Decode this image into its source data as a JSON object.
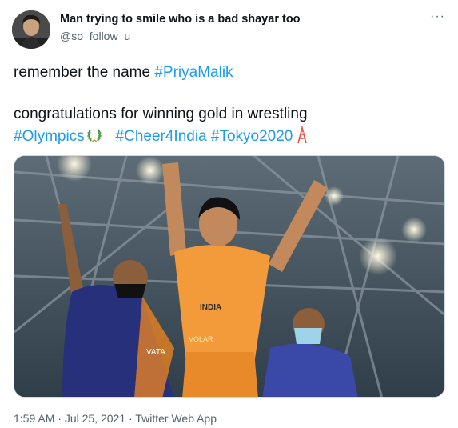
{
  "author": {
    "name": "Man trying to smile who is a bad shayar too",
    "handle": "@so_follow_u"
  },
  "more_icon": "more-dots-icon",
  "text": {
    "line1_prefix": "remember the name ",
    "line1_tag": "#PriyaMalik",
    "line2": "congratulations for winning gold in wrestling",
    "tags": [
      "#Olympics",
      "#Cheer4India",
      "#Tokyo2020"
    ],
    "emoji": [
      "laurel-wreath-icon",
      "tokyo-tower-icon"
    ]
  },
  "media": {
    "jersey_texts": [
      "VATA",
      "INDIA",
      "VOLAR"
    ]
  },
  "meta": {
    "time": "1:59 AM",
    "sep1": " · ",
    "date": "Jul 25, 2021",
    "sep2": " · ",
    "source": "Twitter Web App"
  },
  "colors": {
    "accent": "#1d9bf0",
    "text": "#0f1419",
    "secondary": "#536471"
  }
}
